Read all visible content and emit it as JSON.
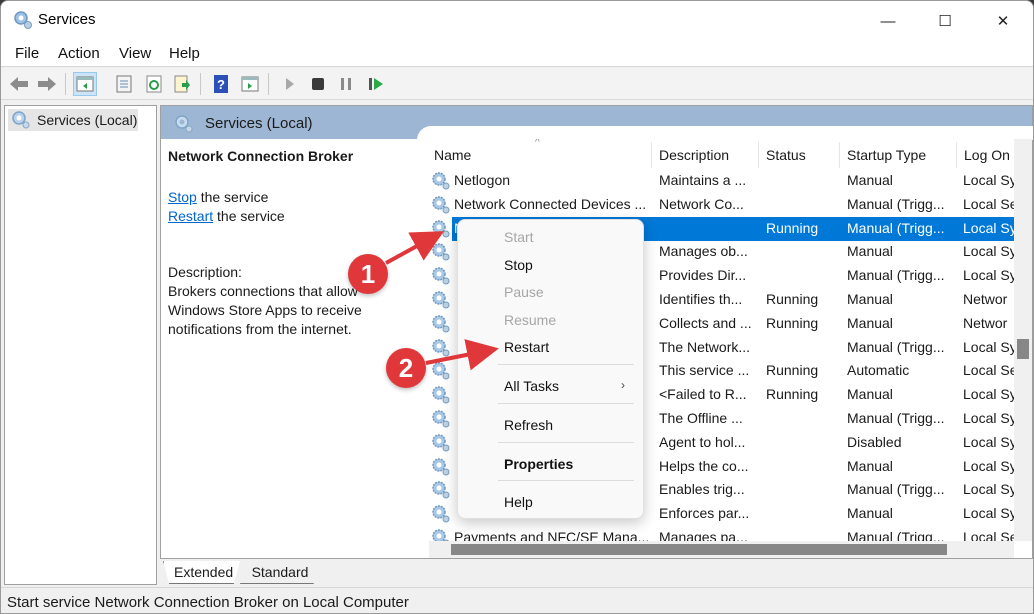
{
  "window": {
    "title": "Services",
    "controls": {
      "minimize": "—",
      "maximize": "☐",
      "close": "✕"
    }
  },
  "menubar": [
    "File",
    "Action",
    "View",
    "Help"
  ],
  "toolbar": {
    "icons": [
      "back-icon",
      "forward-icon",
      "show-hide-console-tree-icon",
      "properties-icon",
      "refresh-icon",
      "export-list-icon",
      "help-icon",
      "show-action-pane-icon",
      "start-service-icon",
      "stop-service-icon",
      "pause-service-icon",
      "restart-service-icon"
    ]
  },
  "tree": {
    "root": "Services (Local)"
  },
  "pane": {
    "header": "Services (Local)",
    "selected_service": "Network Connection Broker",
    "stop_link": "Stop",
    "stop_suffix": " the service",
    "restart_link": "Restart",
    "restart_suffix": " the service",
    "description_label": "Description:",
    "description": "Brokers connections that allow Windows Store Apps to receive notifications from the internet."
  },
  "columns": [
    "Name",
    "Description",
    "Status",
    "Startup Type",
    "Log On"
  ],
  "rows": [
    {
      "name": "Netlogon",
      "description": "Maintains a ...",
      "status": "",
      "startup": "Manual",
      "logon": "Local Sy"
    },
    {
      "name": "Network Connected Devices ...",
      "description": "Network Co...",
      "status": "",
      "startup": "Manual (Trigg...",
      "logon": "Local Se"
    },
    {
      "name": "Network Connection Broker",
      "description": "",
      "status": "Running",
      "startup": "Manual (Trigg...",
      "logon": "Local Sy",
      "selected": true
    },
    {
      "name": "",
      "description": "Manages ob...",
      "status": "",
      "startup": "Manual",
      "logon": "Local Sy"
    },
    {
      "name": "",
      "description": "Provides Dir...",
      "status": "",
      "startup": "Manual (Trigg...",
      "logon": "Local Sy"
    },
    {
      "name": "",
      "description": "Identifies th...",
      "status": "Running",
      "startup": "Manual",
      "logon": "Networ"
    },
    {
      "name": "",
      "description": "Collects and ...",
      "status": "Running",
      "startup": "Manual",
      "logon": "Networ"
    },
    {
      "name": "",
      "description": "The Network...",
      "status": "",
      "startup": "Manual (Trigg...",
      "logon": "Local Sy"
    },
    {
      "name": "",
      "description": "This service ...",
      "status": "Running",
      "startup": "Automatic",
      "logon": "Local Se"
    },
    {
      "name": "",
      "description": "<Failed to R...",
      "status": "Running",
      "startup": "Manual",
      "logon": "Local Sy"
    },
    {
      "name": "",
      "description": "The Offline ...",
      "status": "",
      "startup": "Manual (Trigg...",
      "logon": "Local Sy"
    },
    {
      "name": "",
      "description": "Agent to hol...",
      "status": "",
      "startup": "Disabled",
      "logon": "Local Sy"
    },
    {
      "name": "",
      "description": "Helps the co...",
      "status": "",
      "startup": "Manual",
      "logon": "Local Sy"
    },
    {
      "name": "",
      "description": "Enables trig...",
      "status": "",
      "startup": "Manual (Trigg...",
      "logon": "Local Sy"
    },
    {
      "name": "",
      "description": "Enforces par...",
      "status": "",
      "startup": "Manual",
      "logon": "Local Sy"
    },
    {
      "name": "Payments and NFC/SE Mana...",
      "description": "Manages pa...",
      "status": "",
      "startup": "Manual (Trigg...",
      "logon": "Local Se"
    }
  ],
  "context_menu": {
    "items": [
      {
        "label": "Start",
        "disabled": true
      },
      {
        "label": "Stop",
        "disabled": false
      },
      {
        "label": "Pause",
        "disabled": true
      },
      {
        "label": "Resume",
        "disabled": true
      },
      {
        "label": "Restart",
        "disabled": false
      },
      {
        "label": "All Tasks",
        "submenu": true
      },
      {
        "label": "Refresh"
      },
      {
        "label": "Properties",
        "bold": true
      },
      {
        "label": "Help"
      }
    ],
    "submenu_arrow": "›"
  },
  "annotations": [
    "1",
    "2"
  ],
  "tabs": [
    "Extended",
    "Standard"
  ],
  "statusbar": "Start service Network Connection Broker on Local Computer",
  "colors": {
    "selection": "#0078d7",
    "pane_header": "#9db6d3",
    "link": "#0066cc",
    "annotation": "#e0373b"
  }
}
